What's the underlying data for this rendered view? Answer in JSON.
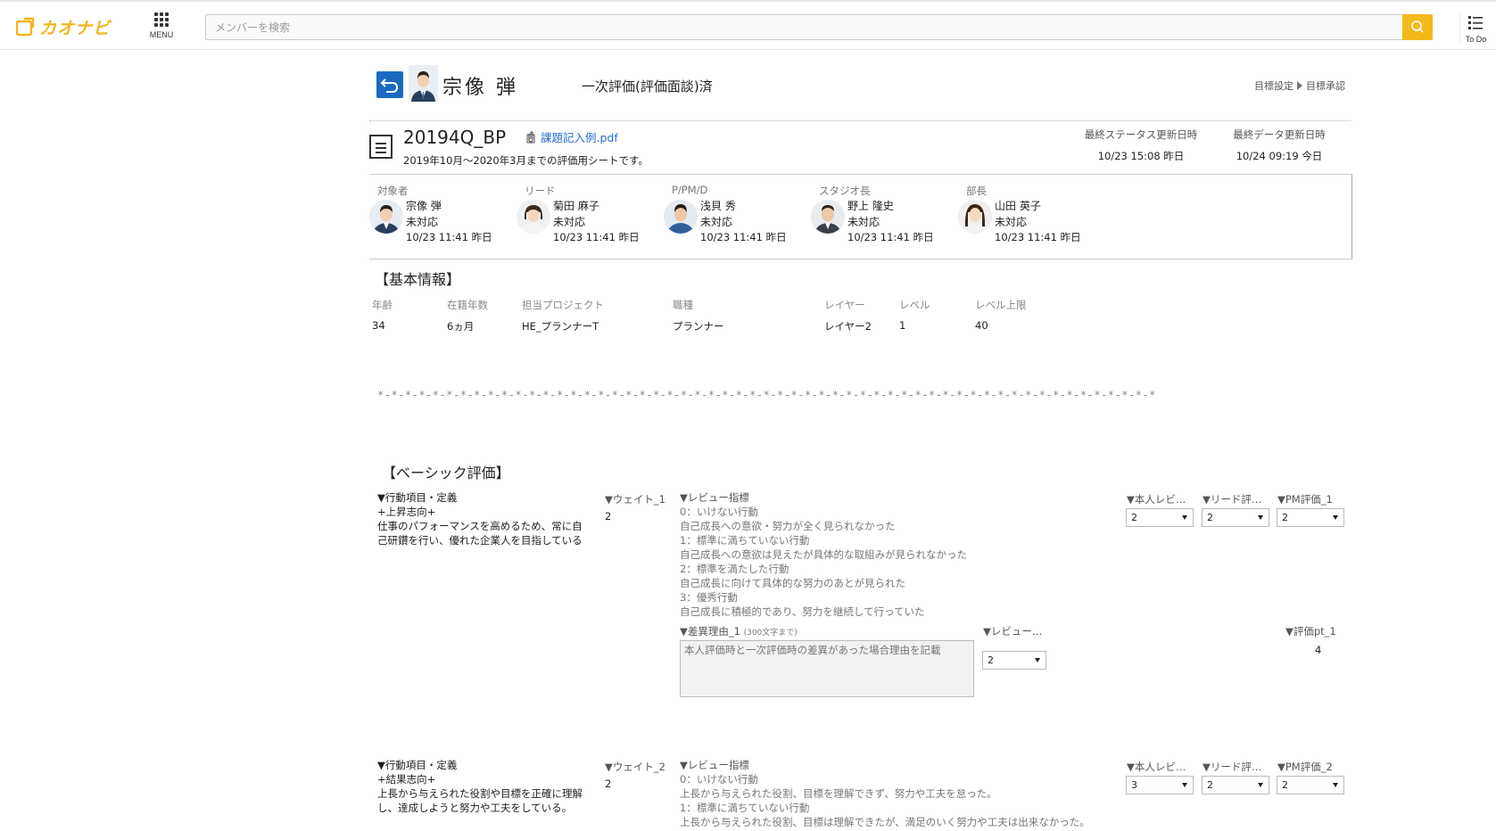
{
  "topbar": {
    "logo_text": "カオナビ",
    "menu_label": "MENU",
    "search_placeholder": "メンバーを検索",
    "todo_label": "To Do"
  },
  "header": {
    "employee_name": "宗像 弾",
    "eval_status": "一次評価(評価面談)済",
    "breadcrumb": [
      "目標設定",
      "目標承認"
    ]
  },
  "sheet": {
    "title": "20194Q_BP",
    "attachment": "課題記入例.pdf",
    "description": "2019年10月～2020年3月までの評価用シートです。",
    "status_updated_label": "最終ステータス更新日時",
    "status_updated_value": "10/23 15:08 昨日",
    "data_updated_label": "最終データ更新日時",
    "data_updated_value": "10/24 09:19 今日"
  },
  "approvers": [
    {
      "role": "対象者",
      "name": "宗像 弾",
      "status": "未対応",
      "date": "10/23 11:41 昨日"
    },
    {
      "role": "リード",
      "name": "菊田 麻子",
      "status": "未対応",
      "date": "10/23 11:41 昨日"
    },
    {
      "role": "P/PM/D",
      "name": "浅貝 秀",
      "status": "未対応",
      "date": "10/23 11:41 昨日"
    },
    {
      "role": "スタジオ長",
      "name": "野上 隆史",
      "status": "未対応",
      "date": "10/23 11:41 昨日"
    },
    {
      "role": "部長",
      "name": "山田 英子",
      "status": "未対応",
      "date": "10/23 11:41 昨日"
    }
  ],
  "basic_info": {
    "title": "【基本情報】",
    "fields": [
      {
        "label": "年齢",
        "value": "34"
      },
      {
        "label": "在籍年数",
        "value": "6ヵ月"
      },
      {
        "label": "担当プロジェクト",
        "value": "HE_プランナーT"
      },
      {
        "label": "職種",
        "value": "プランナー"
      },
      {
        "label": "レイヤー",
        "value": "レイヤー2"
      },
      {
        "label": "レベル",
        "value": "1"
      },
      {
        "label": "レベル上限",
        "value": "40"
      }
    ]
  },
  "separator": "*-*-*-*-*-*-*-*-*-*-*-*-*-*-*-*-*-*-*-*-*-*-*-*-*-*-*-*-*-*-*-*-*-*-*-*-*-*-*-*-*-*-*-*-*-*-*-*-*-*-*-*-*-*-*-*-*",
  "basic_eval": {
    "title": "【ベーシック評価】",
    "items": [
      {
        "item_header": "▼行動項目・定義",
        "item_name": "+上昇志向+",
        "item_def": "仕事のパフォーマンスを高めるため、常に自己研鑽を行い、優れた企業人を目指している",
        "weight_header": "▼ウェイト_1",
        "weight": "2",
        "review_header": "▼レビュー指標",
        "review_lines": [
          "0：いけない行動",
          "自己成長への意欲・努力が全く見られなかった",
          "1：標準に満ちていない行動",
          "自己成長への意欲は見えたが具体的な取組みが見られなかった",
          "2：標準を満たした行動",
          "自己成長に向けて具体的な努力のあとが見られた",
          "3：優秀行動",
          "自己成長に積極的であり、努力を継続して行っていた"
        ],
        "self_header": "▼本人レビ…",
        "lead_header": "▼リード評…",
        "pm_header": "▼PM評価_1",
        "self_value": "2",
        "lead_value": "2",
        "pm_value": "2",
        "diff_header": "▼差異理由_1",
        "diff_note": "(300文字まで)",
        "diff_placeholder": "本人評価時と一次評価時の差異があった場合理由を記載",
        "review2_header": "▼レビュー…",
        "review2_value": "2",
        "pt_header": "▼評価pt_1",
        "pt_value": "4"
      },
      {
        "item_header": "▼行動項目・定義",
        "item_name": "+結果志向+",
        "item_def": "上長から与えられた役割や目標を正確に理解し、達成しようと努力や工夫をしている。",
        "weight_header": "▼ウェイト_2",
        "weight": "2",
        "review_header": "▼レビュー指標",
        "review_lines": [
          "0：いけない行動",
          "上長から与えられた役割、目標を理解できず、努力や工夫を怠った。",
          "1：標準に満ちていない行動",
          "上長から与えられた役割、目標は理解できたが、満足のいく努力や工夫は出来なかった。"
        ],
        "self_header": "▼本人レビ…",
        "lead_header": "▼リード評…",
        "pm_header": "▼PM評価_2",
        "self_value": "3",
        "lead_value": "2",
        "pm_value": "2"
      }
    ]
  },
  "colors": {
    "accent": "#f5b91b",
    "back_button": "#1a6ac3",
    "link": "#2a6fd0"
  }
}
